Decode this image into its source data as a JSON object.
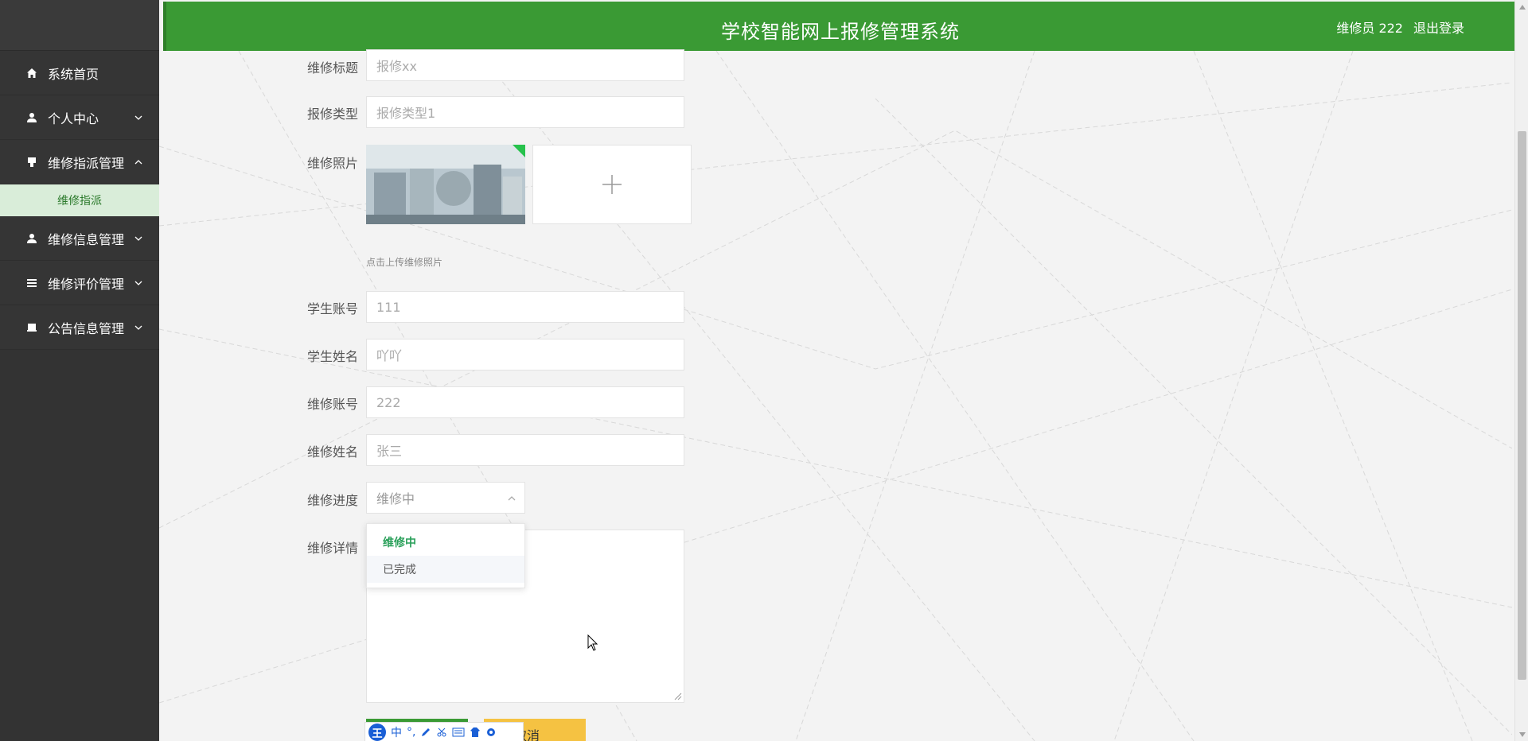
{
  "header": {
    "title": "学校智能网上报修管理系统",
    "user_label": "维修员 222",
    "logout_label": "退出登录",
    "color": "#3a9a34"
  },
  "sidebar": {
    "items": [
      {
        "label": "系统首页",
        "icon": "home-icon"
      },
      {
        "label": "个人中心",
        "icon": "user-icon"
      },
      {
        "label": "维修指派管理",
        "icon": "dispatch-icon",
        "expanded": true
      },
      {
        "label": "维修信息管理",
        "icon": "user-icon"
      },
      {
        "label": "维修评价管理",
        "icon": "list-icon"
      },
      {
        "label": "公告信息管理",
        "icon": "notice-icon"
      }
    ],
    "subitem": {
      "label": "维修指派"
    }
  },
  "form": {
    "title_label": "维修标题",
    "title_value": "报修xx",
    "type_label": "报修类型",
    "type_value": "报修类型1",
    "photo_label": "维修照片",
    "upload_hint": "点击上传维修照片",
    "student_account_label": "学生账号",
    "student_account_value": "111",
    "student_name_label": "学生姓名",
    "student_name_value": "吖吖",
    "repair_account_label": "维修账号",
    "repair_account_value": "222",
    "repair_name_label": "维修姓名",
    "repair_name_value": "张三",
    "progress_label": "维修进度",
    "progress_value": "维修中",
    "progress_options": [
      "维修中",
      "已完成"
    ],
    "detail_label": "维修详情",
    "submit_label": "",
    "cancel_label": "取消"
  },
  "ime": {
    "logo": "王",
    "mode": "中",
    "punct": "°,"
  }
}
